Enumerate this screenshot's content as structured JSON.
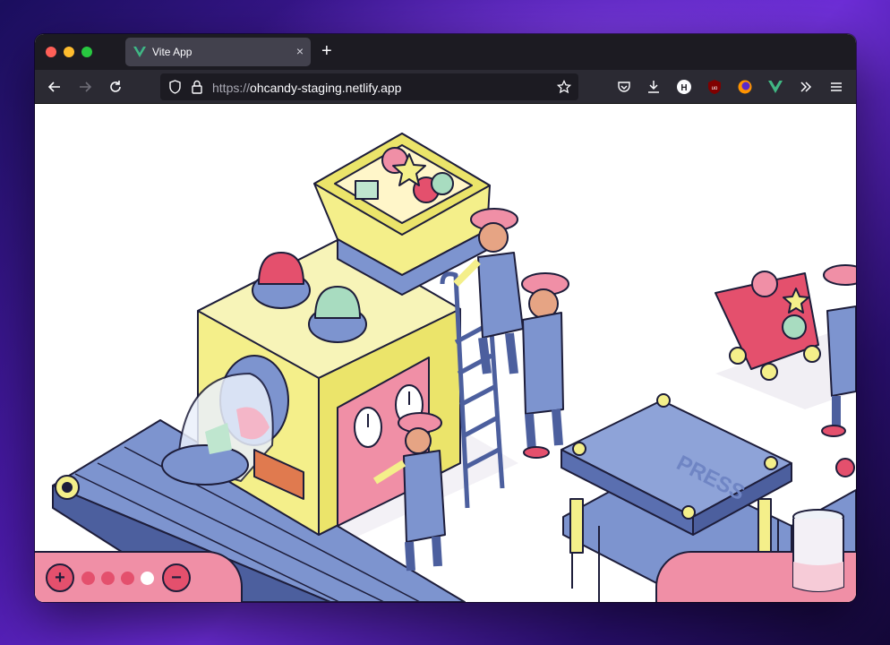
{
  "browser": {
    "tab": {
      "title": "Vite App",
      "close_glyph": "×",
      "favicon": "vue-logo-icon"
    },
    "new_tab_glyph": "+",
    "url": {
      "scheme": "https://",
      "host": "ohcandy-staging.netlify.app"
    },
    "nav_icons": [
      "back-icon",
      "forward-icon",
      "reload-icon",
      "shield-icon",
      "lock-icon",
      "bookmark-star-icon",
      "pocket-icon",
      "download-icon",
      "honey-extension-icon",
      "ublock-icon",
      "firefox-extension-icon",
      "vue-devtools-icon",
      "overflow-icon",
      "menu-icon"
    ]
  },
  "scene": {
    "press_label": "PRESS",
    "colors": {
      "yellow": "#f4ef8a",
      "pink": "#f08fa6",
      "blue": "#7d94cf",
      "red": "#e4506d",
      "mint": "#a8dcc0",
      "outline": "#1d1d3a"
    }
  },
  "controls": {
    "plus_label": "+",
    "minus_label": "−",
    "active_dot": 4
  }
}
